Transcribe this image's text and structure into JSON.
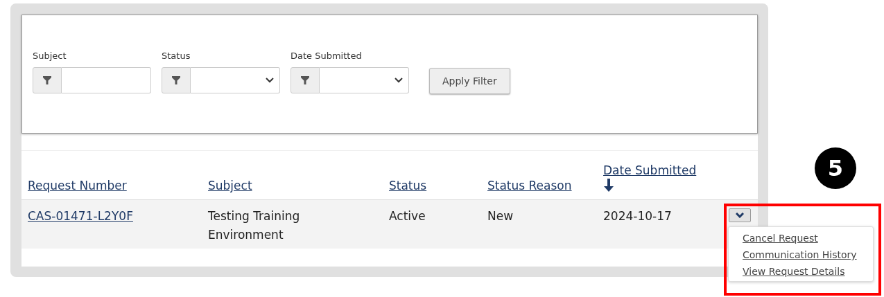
{
  "filters": [
    {
      "label": "Subject",
      "kind": "text"
    },
    {
      "label": "Status",
      "kind": "select"
    },
    {
      "label": "Date Submitted",
      "kind": "select"
    }
  ],
  "apply_button": "Apply Filter",
  "table": {
    "columns": [
      {
        "label": "Request Number",
        "sorted": false
      },
      {
        "label": "Subject",
        "sorted": false
      },
      {
        "label": "Status",
        "sorted": false
      },
      {
        "label": "Status Reason",
        "sorted": false
      },
      {
        "label": "Date Submitted",
        "sorted": true
      }
    ],
    "rows": [
      {
        "cells": [
          "CAS-01471-L2Y0F",
          "Testing Training Environment",
          "Active",
          "New",
          "2024-10-17"
        ],
        "menu_expanded": true
      }
    ]
  },
  "row_menu": [
    "Cancel Request",
    "Communication History",
    "View Request Details"
  ],
  "callout": {
    "number": "5"
  }
}
